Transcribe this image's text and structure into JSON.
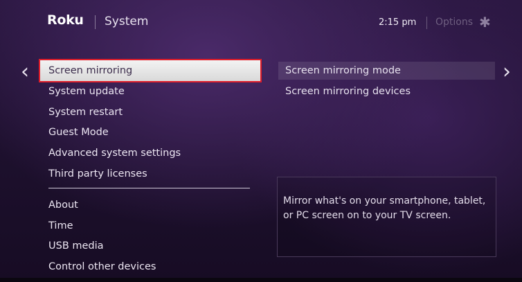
{
  "header": {
    "brand": "Roku",
    "title": "System",
    "clock": "2:15  pm",
    "options_label": "Options",
    "options_icon": "✱"
  },
  "nav": {
    "left_arrow": "‹",
    "right_arrow": "›"
  },
  "menu": {
    "items": [
      {
        "label": "Screen mirroring",
        "selected": true
      },
      {
        "label": "System update"
      },
      {
        "label": "System restart"
      },
      {
        "label": "Guest Mode"
      },
      {
        "label": "Advanced system settings"
      },
      {
        "label": "Third party licenses"
      },
      {
        "label": "About"
      },
      {
        "label": "Time"
      },
      {
        "label": "USB media"
      },
      {
        "label": "Control other devices"
      }
    ]
  },
  "submenu": {
    "items": [
      {
        "label": "Screen mirroring mode"
      },
      {
        "label": "Screen mirroring devices"
      }
    ]
  },
  "info": {
    "text": "Mirror what's on your smartphone, tablet, or PC screen on to your TV screen."
  },
  "colors": {
    "selection_outline": "#e01e2a",
    "background": "#2a1740"
  }
}
